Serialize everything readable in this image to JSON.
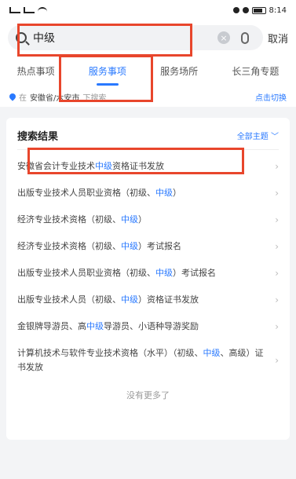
{
  "status": {
    "time": "8:14"
  },
  "search": {
    "query": "中级",
    "cancel": "取消"
  },
  "tabs": [
    {
      "label": "热点事项"
    },
    {
      "label": "服务事项"
    },
    {
      "label": "服务场所"
    },
    {
      "label": "长三角专题"
    }
  ],
  "location": {
    "prefix": "在",
    "place": "安徽省/六安市",
    "suffix": "下搜索",
    "switch": "点击切换"
  },
  "results": {
    "title": "搜索结果",
    "all_topics": "全部主题",
    "items": [
      {
        "a": "安徽省会计专业技术",
        "h": "中级",
        "b": "资格证书发放"
      },
      {
        "a": "出版专业技术人员职业资格（初级、",
        "h": "中级",
        "b": "）"
      },
      {
        "a": "经济专业技术资格（初级、",
        "h": "中级",
        "b": "）"
      },
      {
        "a": "经济专业技术资格（初级、",
        "h": "中级",
        "b": "）考试报名"
      },
      {
        "a": "出版专业技术人员职业资格（初级、",
        "h": "中级",
        "b": "）考试报名"
      },
      {
        "a": "出版专业技术人员（初级、",
        "h": "中级",
        "b": "）资格证书发放"
      },
      {
        "a": "金银牌导游员、高",
        "h": "中级",
        "b": "导游员、小语种导游奖励"
      },
      {
        "a": "计算机技术与软件专业技术资格（水平）（初级、",
        "h": "中级",
        "b": "、高级）证书发放"
      }
    ],
    "no_more": "没有更多了"
  }
}
